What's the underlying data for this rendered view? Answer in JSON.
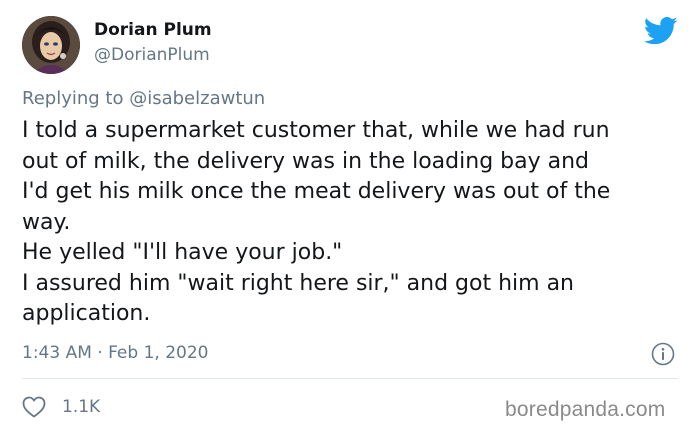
{
  "author": {
    "display_name": "Dorian Plum",
    "handle": "@DorianPlum",
    "avatar_icon": "portrait-avatar"
  },
  "reply": {
    "prefix": "Replying to",
    "mention": "@isabelzawtun"
  },
  "body_lines": [
    "I told a supermarket customer that, while we had run",
    "out of milk, the delivery was in the loading bay and",
    "I'd get his milk once the meat delivery was out of the",
    "way.",
    "He yelled \"I'll have your job.\"",
    "I assured him \"wait right here sir,\" and got him an",
    "application."
  ],
  "meta": {
    "timestamp": "1:43 AM · Feb 1, 2020"
  },
  "stats": {
    "likes": "1.1K"
  },
  "watermark": "boredpanda.com",
  "colors": {
    "twitter_blue": "#1da1f2",
    "text": "#14171a",
    "secondary": "#657786",
    "divider": "#e1e8ed"
  }
}
